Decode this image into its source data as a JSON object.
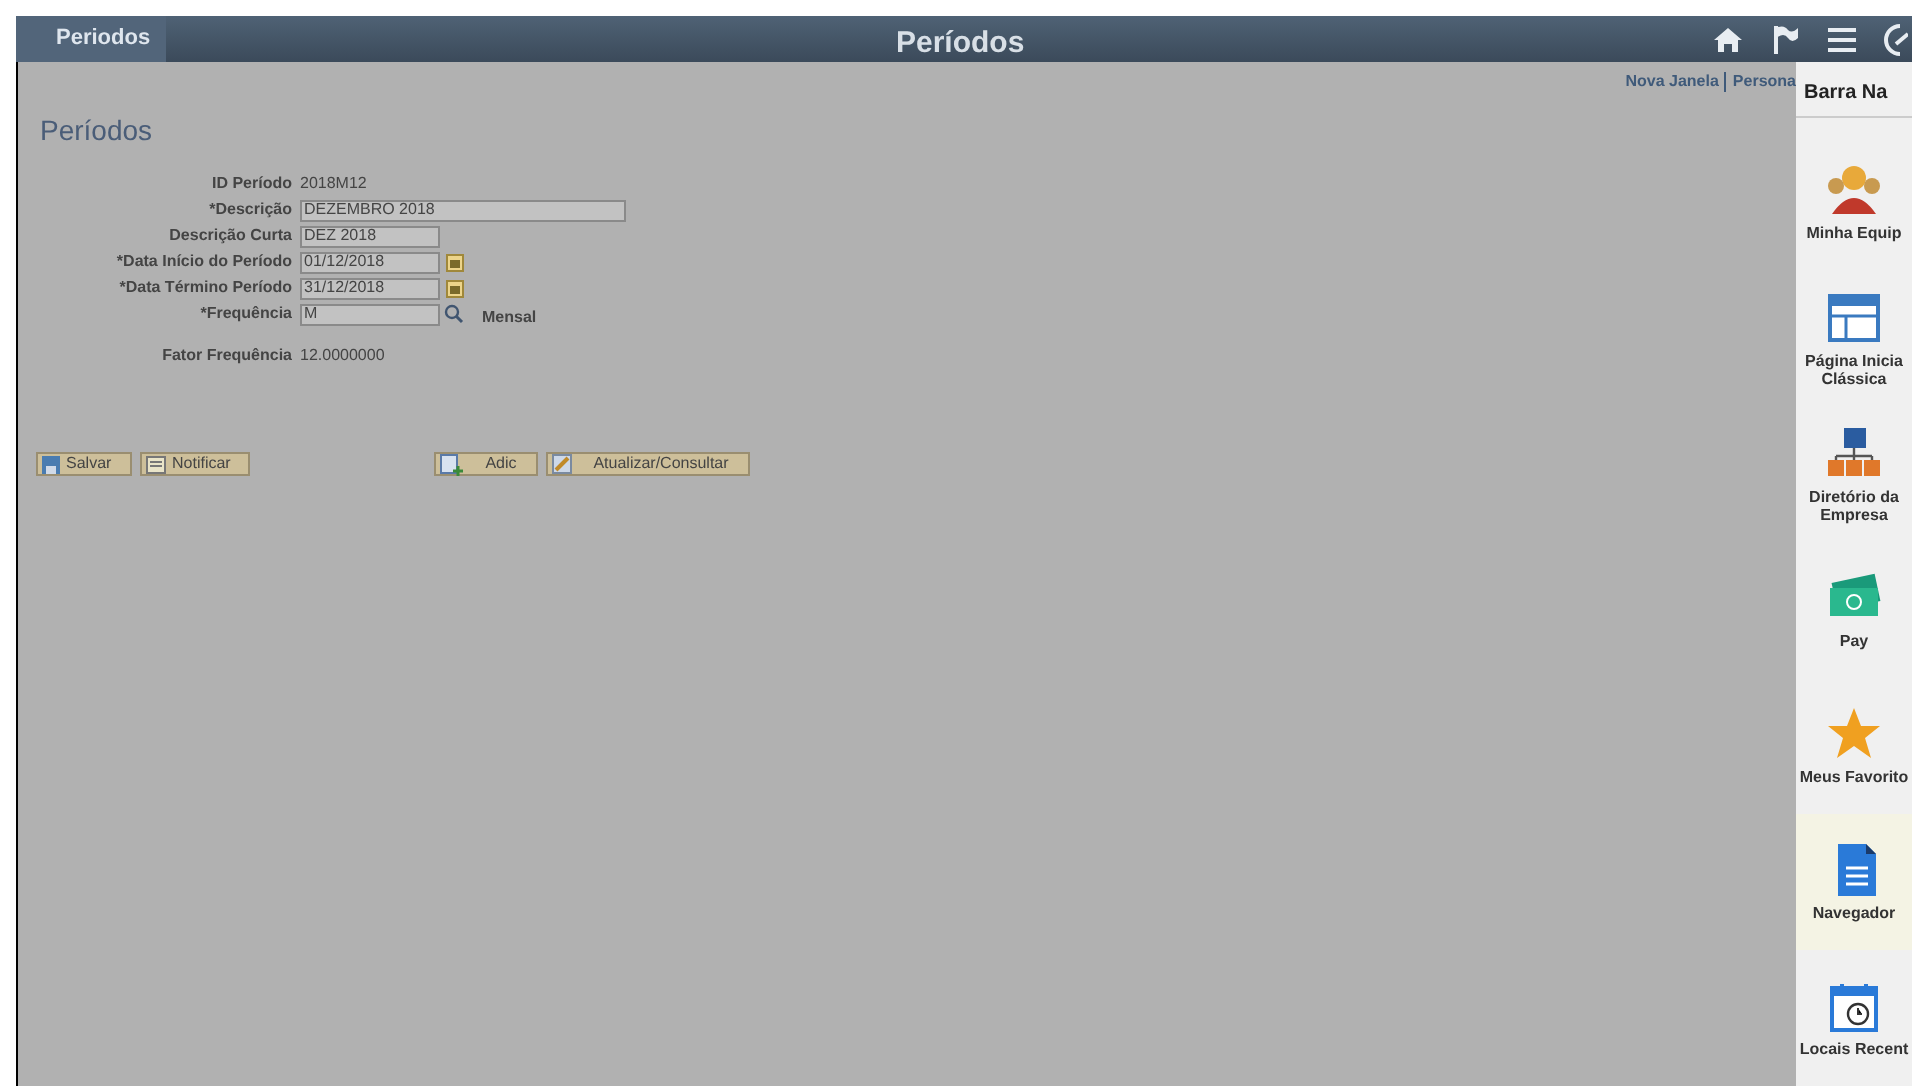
{
  "header": {
    "back": "Periodos",
    "title": "Períodos"
  },
  "links": [
    "Nova Janela",
    "Persona"
  ],
  "page_title": "Períodos",
  "fields": [
    {
      "kind": "text",
      "label": "ID Período",
      "value": "2018M12"
    },
    {
      "kind": "wide",
      "label": "*Descrição",
      "value": "DEZEMBRO 2018"
    },
    {
      "kind": "input",
      "label": "Descrição Curta",
      "value": "DEZ 2018"
    },
    {
      "kind": "date",
      "label": "*Data Início do Período",
      "value": "01/12/2018"
    },
    {
      "kind": "date",
      "label": "*Data Término Período",
      "value": "31/12/2018"
    },
    {
      "kind": "lookup",
      "label": "*Frequência",
      "value": "M",
      "note": "Mensal"
    },
    {
      "kind": "text",
      "label": "Fator Frequência",
      "value": "12.0000000"
    }
  ],
  "buttons_left": [
    {
      "kind": "save",
      "label": "Salvar"
    },
    {
      "kind": "notify",
      "label": "Notificar"
    }
  ],
  "buttons_right": [
    {
      "kind": "add",
      "label": "Adic"
    },
    {
      "kind": "update",
      "label": "Atualizar/Consultar"
    }
  ],
  "navbar": {
    "title": "Barra Na",
    "items": [
      {
        "kind": "team",
        "lines": [
          "Minha Equip"
        ],
        "selected": false
      },
      {
        "kind": "classic",
        "lines": [
          "Página Inicia",
          "Clássica"
        ],
        "selected": false
      },
      {
        "kind": "directory",
        "lines": [
          "Diretório da",
          "Empresa"
        ],
        "selected": false
      },
      {
        "kind": "pay",
        "lines": [
          "Pay"
        ],
        "selected": false
      },
      {
        "kind": "favorites",
        "lines": [
          "Meus Favorito"
        ],
        "selected": false
      },
      {
        "kind": "navigator",
        "lines": [
          "Navegador"
        ],
        "selected": true
      },
      {
        "kind": "recent",
        "lines": [
          "Locais Recent"
        ],
        "selected": false
      }
    ]
  }
}
